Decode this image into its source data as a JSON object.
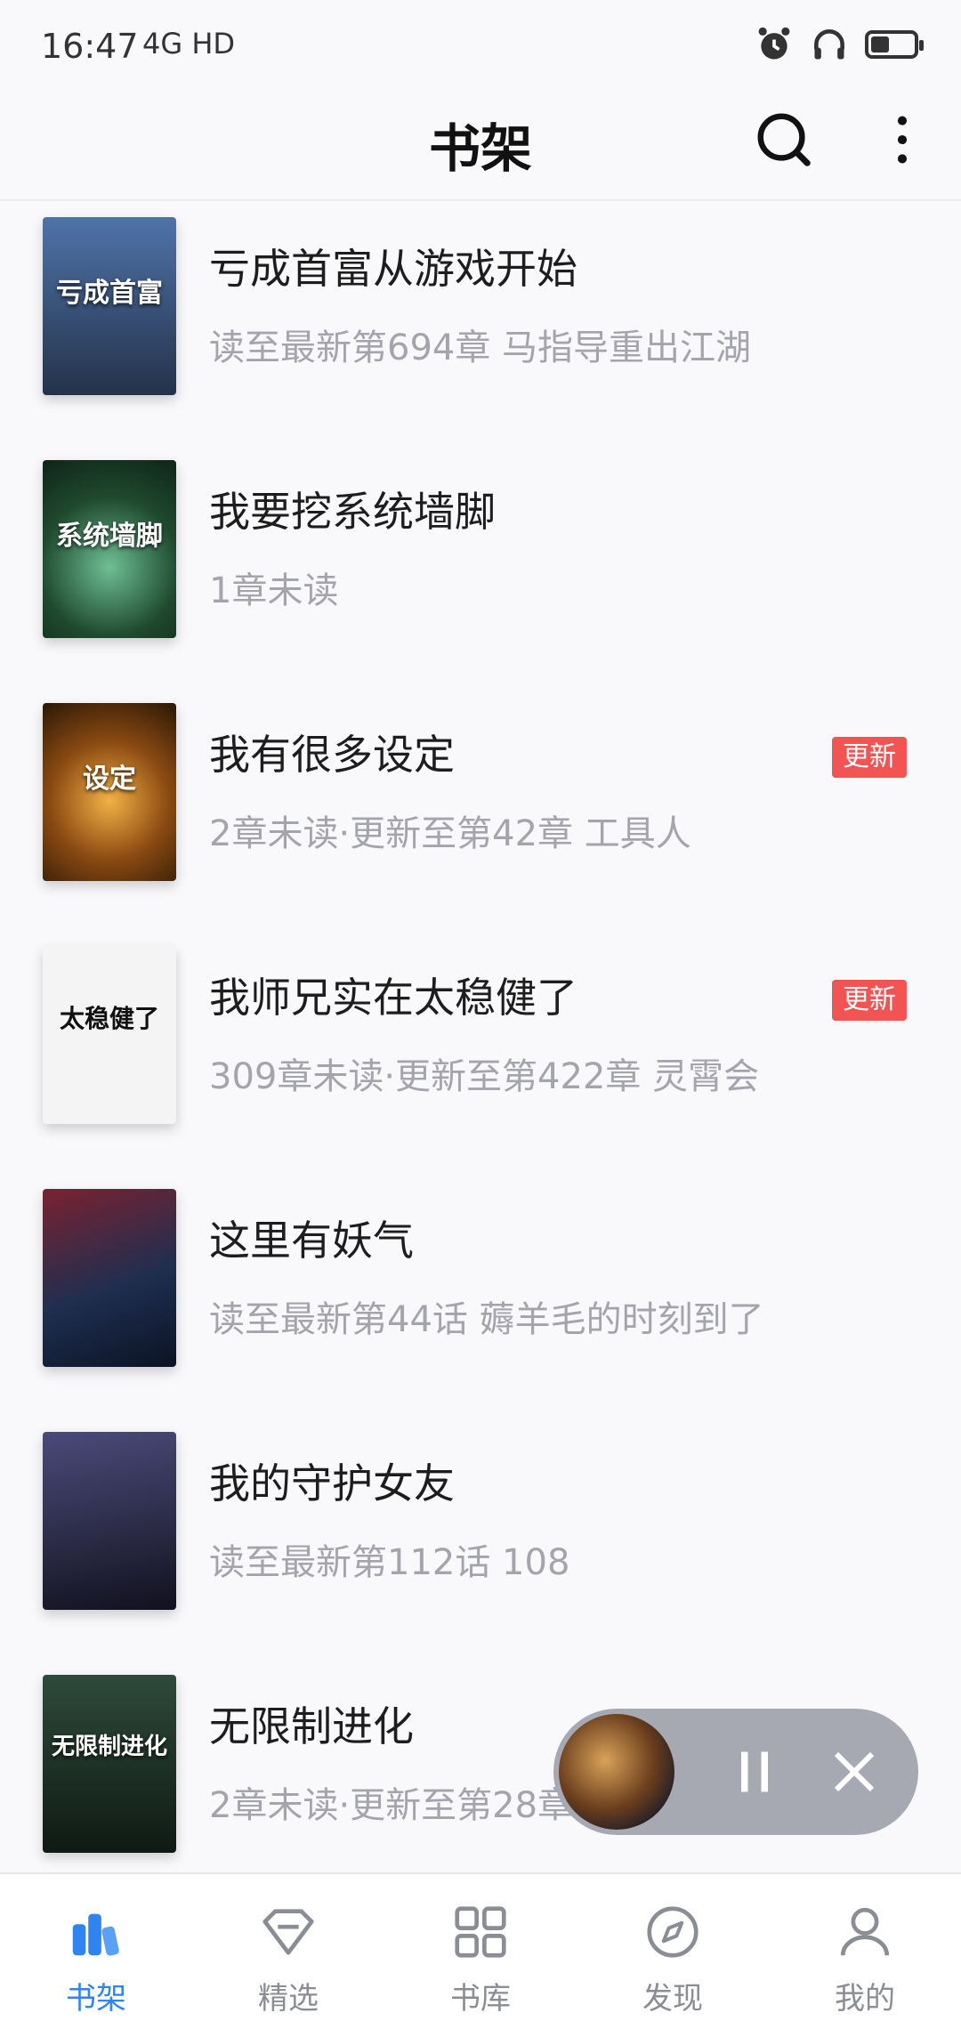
{
  "status": {
    "time": "16:47",
    "network": "4G HD",
    "icons": [
      "alarm-icon",
      "headphones-icon",
      "battery-icon"
    ]
  },
  "header": {
    "title": "书架",
    "icons": [
      "search-icon",
      "more-vertical-icon"
    ]
  },
  "books": [
    {
      "title": "亏成首富从游戏开始",
      "subtitle": "读至最新第694章 马指导重出江湖",
      "badge": "",
      "cover_color": "#3a5a86",
      "cover_text": "亏成首富"
    },
    {
      "title": "我要挖系统墙脚",
      "subtitle": "1章未读",
      "badge": "",
      "cover_color": "#1f4a2e",
      "cover_text": "系统墙脚"
    },
    {
      "title": "我有很多设定",
      "subtitle": "2章未读·更新至第42章 工具人",
      "badge": "更新",
      "cover_color": "#6b3e12",
      "cover_text": "设定"
    },
    {
      "title": "我师兄实在太稳健了",
      "subtitle": "309章未读·更新至第422章 灵霄会",
      "badge": "更新",
      "cover_color": "#f2f2f2",
      "cover_text": "太稳健了"
    },
    {
      "title": "这里有妖气",
      "subtitle": "读至最新第44话  薅羊毛的时刻到了",
      "badge": "",
      "cover_color": "#1f2e50",
      "cover_text": ""
    },
    {
      "title": "我的守护女友",
      "subtitle": "读至最新第112话 108",
      "badge": "",
      "cover_color": "#2c2c48",
      "cover_text": ""
    },
    {
      "title": "无限制进化",
      "subtitle": "2章未读·更新至第28章",
      "badge": "",
      "cover_color": "#1b2b22",
      "cover_text": "无限制进化"
    }
  ],
  "player": {
    "icons": [
      "pause-icon",
      "close-icon"
    ]
  },
  "nav": {
    "items": [
      {
        "label": "书架",
        "icon": "bookshelf-icon",
        "active": true
      },
      {
        "label": "精选",
        "icon": "diamond-icon",
        "active": false
      },
      {
        "label": "书库",
        "icon": "grid-icon",
        "active": false
      },
      {
        "label": "发现",
        "icon": "compass-icon",
        "active": false
      },
      {
        "label": "我的",
        "icon": "user-icon",
        "active": false
      }
    ]
  },
  "colors": {
    "accent": "#2f84f0",
    "badge": "#f25454",
    "subtitle": "#a4a4ac",
    "background": "#f9f9fb"
  }
}
